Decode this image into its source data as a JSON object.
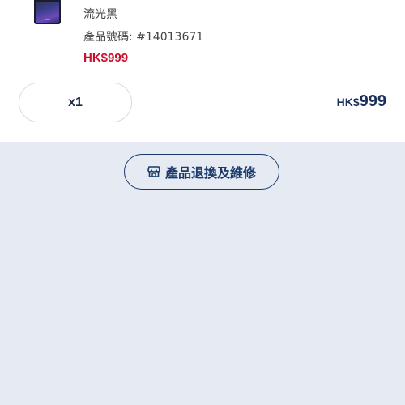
{
  "product": {
    "variant": "流光黑",
    "sku_label": "產品號碼:",
    "sku_value": "#14013671",
    "unit_price": "HK$999"
  },
  "quantity": {
    "label": "x1"
  },
  "total": {
    "currency": "HK$",
    "amount": "999"
  },
  "actions": {
    "return_repair_label": "產品退換及維修",
    "return_repair_icon": "store-icon"
  },
  "colors": {
    "accent": "#1b3a6b",
    "price_red": "#c8102e",
    "background": "#e5eaf3"
  }
}
